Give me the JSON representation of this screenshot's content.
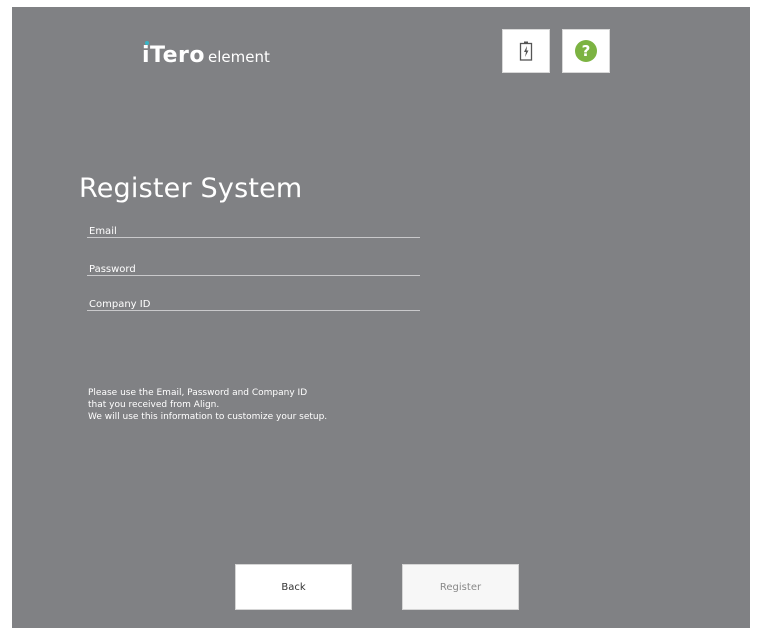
{
  "logo": {
    "brand": "iTero",
    "suffix": "element",
    "brand_accent_color": "#37b6c7"
  },
  "toolbar": {
    "battery_icon": "battery-charging-icon",
    "help_icon": "help-question-icon",
    "help_glyph": "?",
    "help_color": "#7cb342"
  },
  "form": {
    "title": "Register System",
    "email": {
      "placeholder": "Email",
      "value": ""
    },
    "password": {
      "placeholder": "Password",
      "value": ""
    },
    "company": {
      "placeholder": "Company ID",
      "value": ""
    }
  },
  "info": {
    "lines": [
      "Please use the Email, Password and Company ID",
      "that you received from Align.",
      "We will use this information to customize your setup."
    ]
  },
  "actions": {
    "back_label": "Back",
    "register_label": "Register"
  },
  "colors": {
    "background": "#808184",
    "text": "#ffffff"
  }
}
